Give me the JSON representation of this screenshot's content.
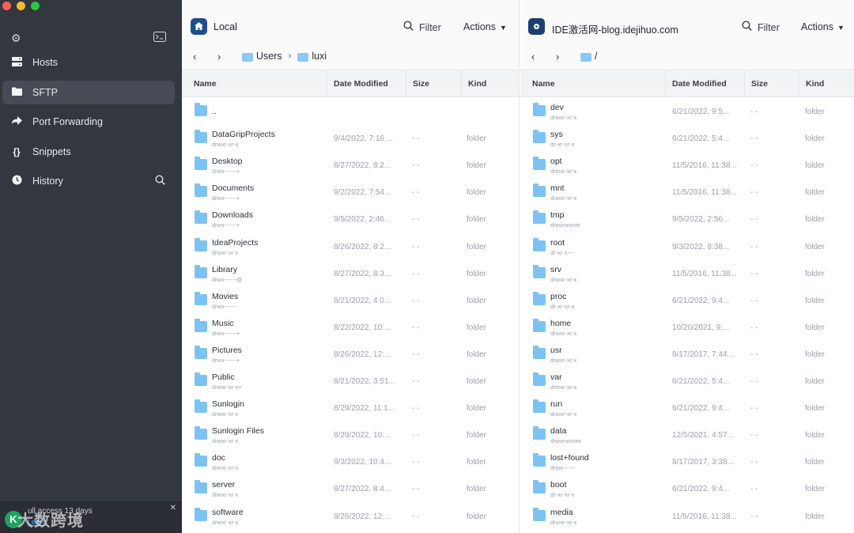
{
  "sidebar": {
    "items": [
      {
        "label": "Hosts",
        "icon": "hosts-icon"
      },
      {
        "label": "SFTP",
        "icon": "folder-icon"
      },
      {
        "label": "Port Forwarding",
        "icon": "forward-icon"
      },
      {
        "label": "Snippets",
        "icon": "braces-icon"
      },
      {
        "label": "History",
        "icon": "clock-icon"
      }
    ],
    "active": "SFTP",
    "promo": {
      "text": "ull access 13 days",
      "link": "Learn",
      "watermark": "大数跨境"
    }
  },
  "left_pane": {
    "title": "Local",
    "filter_label": "Filter",
    "actions_label": "Actions",
    "path": [
      "Users",
      "luxi"
    ],
    "columns": [
      "Name",
      "Date Modified",
      "Size",
      "Kind"
    ],
    "files": [
      {
        "name": "..",
        "perm": "",
        "date": "",
        "size": "",
        "kind": ""
      },
      {
        "name": "DataGripProjects",
        "perm": "drwxr-xr-x",
        "date": "9/4/2022, 7:16 ...",
        "size": "- -",
        "kind": "folder"
      },
      {
        "name": "Desktop",
        "perm": "drwx------+",
        "date": "8/27/2022, 8:2...",
        "size": "- -",
        "kind": "folder"
      },
      {
        "name": "Documents",
        "perm": "drwx------+",
        "date": "9/2/2022, 7:54...",
        "size": "- -",
        "kind": "folder"
      },
      {
        "name": "Downloads",
        "perm": "drwx------+",
        "date": "9/5/2022, 2:46...",
        "size": "- -",
        "kind": "folder"
      },
      {
        "name": "IdeaProjects",
        "perm": "drwxr-xr-x",
        "date": "8/26/2022, 8:2...",
        "size": "- -",
        "kind": "folder"
      },
      {
        "name": "Library",
        "perm": "drwx------@",
        "date": "8/27/2022, 8:3...",
        "size": "- -",
        "kind": "folder"
      },
      {
        "name": "Movies",
        "perm": "drwx------",
        "date": "8/21/2022, 4:0...",
        "size": "- -",
        "kind": "folder"
      },
      {
        "name": "Music",
        "perm": "drwx------+",
        "date": "8/22/2022, 10:...",
        "size": "- -",
        "kind": "folder"
      },
      {
        "name": "Pictures",
        "perm": "drwx------+",
        "date": "8/26/2022, 12:...",
        "size": "- -",
        "kind": "folder"
      },
      {
        "name": "Public",
        "perm": "drwxr-xr-x+",
        "date": "8/21/2022, 3:51...",
        "size": "- -",
        "kind": "folder"
      },
      {
        "name": "Sunlogin",
        "perm": "drwxr-xr-x",
        "date": "8/29/2022, 11:1...",
        "size": "- -",
        "kind": "folder"
      },
      {
        "name": "Sunlogin Files",
        "perm": "drwxr-xr-x",
        "date": "8/29/2022, 10:...",
        "size": "- -",
        "kind": "folder"
      },
      {
        "name": "doc",
        "perm": "drwxr-xr-x",
        "date": "9/3/2022, 10:4...",
        "size": "- -",
        "kind": "folder"
      },
      {
        "name": "server",
        "perm": "drwxr-xr-x",
        "date": "8/27/2022, 8:4...",
        "size": "- -",
        "kind": "folder"
      },
      {
        "name": "software",
        "perm": "drwxr-xr-x",
        "date": "8/26/2022, 12:...",
        "size": "- -",
        "kind": "folder"
      }
    ]
  },
  "right_pane": {
    "title": "IDE激活网-blog.idejihuo.com",
    "filter_label": "Filter",
    "actions_label": "Actions",
    "path": [
      "/"
    ],
    "columns": [
      "Name",
      "Date Modified",
      "Size",
      "Kind"
    ],
    "files": [
      {
        "name": "dev",
        "perm": "drwxr-xr-x",
        "date": "6/21/2022, 9:5...",
        "size": "- -",
        "kind": "folder"
      },
      {
        "name": "sys",
        "perm": "dr-xr-xr-x",
        "date": "6/21/2022, 5:4...",
        "size": "- -",
        "kind": "folder"
      },
      {
        "name": "opt",
        "perm": "drwxr-xr-x",
        "date": "11/5/2016, 11:38...",
        "size": "- -",
        "kind": "folder"
      },
      {
        "name": "mnt",
        "perm": "drwxr-xr-x",
        "date": "11/5/2016, 11:38...",
        "size": "- -",
        "kind": "folder"
      },
      {
        "name": "tmp",
        "perm": "drwxrwxrwt",
        "date": "9/5/2022, 2:56...",
        "size": "- -",
        "kind": "folder"
      },
      {
        "name": "root",
        "perm": "dr-xr-x---",
        "date": "9/3/2022, 8:38...",
        "size": "- -",
        "kind": "folder"
      },
      {
        "name": "srv",
        "perm": "drwxr-xr-x",
        "date": "11/5/2016, 11:38...",
        "size": "- -",
        "kind": "folder"
      },
      {
        "name": "proc",
        "perm": "dr-xr-xr-x",
        "date": "6/21/2022, 9:4...",
        "size": "- -",
        "kind": "folder"
      },
      {
        "name": "home",
        "perm": "drwxr-xr-x",
        "date": "10/20/2021, 9:...",
        "size": "- -",
        "kind": "folder"
      },
      {
        "name": "usr",
        "perm": "drwxr-xr-x",
        "date": "8/17/2017, 7:44...",
        "size": "- -",
        "kind": "folder"
      },
      {
        "name": "var",
        "perm": "drwxr-xr-x",
        "date": "6/21/2022, 5:4...",
        "size": "- -",
        "kind": "folder"
      },
      {
        "name": "run",
        "perm": "drwxr-xr-x",
        "date": "6/21/2022, 9:4...",
        "size": "- -",
        "kind": "folder"
      },
      {
        "name": "data",
        "perm": "drwxrwxrwx",
        "date": "12/5/2021, 4:57...",
        "size": "- -",
        "kind": "folder"
      },
      {
        "name": "lost+found",
        "perm": "drwx------",
        "date": "8/17/2017, 3:38...",
        "size": "- -",
        "kind": "folder"
      },
      {
        "name": "boot",
        "perm": "dr-xr-xr-x",
        "date": "6/21/2022, 9:4...",
        "size": "- -",
        "kind": "folder"
      },
      {
        "name": "media",
        "perm": "drwxr-xr-x",
        "date": "11/5/2016, 11:38...",
        "size": "- -",
        "kind": "folder"
      }
    ]
  }
}
